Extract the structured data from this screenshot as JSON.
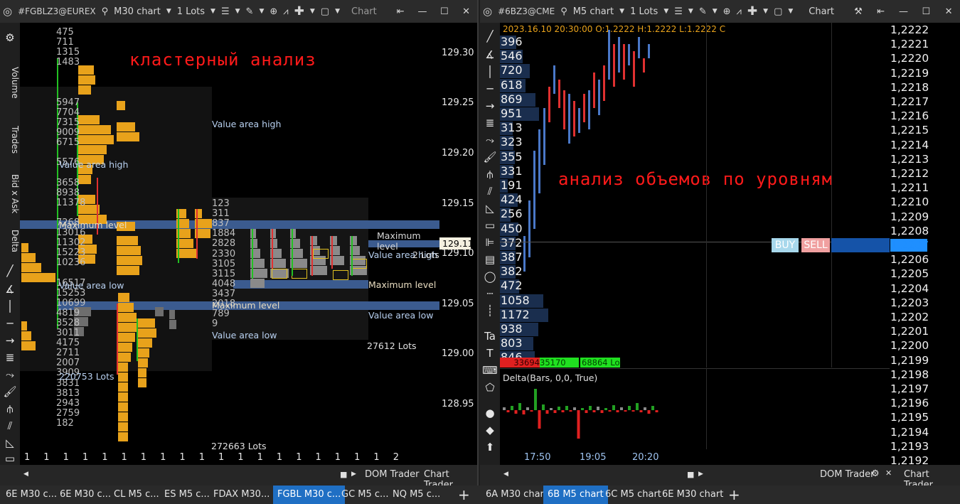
{
  "left": {
    "symbol": "#FGBLZ3@EUREX",
    "chart_type": "M30 chart",
    "lots": "1 Lots",
    "chart_label": "Chart",
    "annotation": "кластерный анализ",
    "side_tabs": [
      "Volume",
      "Trades",
      "Bid x Ask",
      "Delta"
    ],
    "prices": [
      "129.30",
      "129.25",
      "129.20",
      "129.15",
      "129.10",
      "129.05",
      "129.00",
      "128.95"
    ],
    "current_price": "129.11",
    "col1_values": [
      "475",
      "711",
      "1315",
      "1483",
      "",
      "",
      "",
      "5947",
      "7704",
      "7315",
      "9009",
      "6715",
      "",
      "5576",
      "",
      "3658",
      "8938",
      "11378",
      "",
      "7268",
      "13016",
      "11302",
      "15223",
      "10236",
      "",
      "16517",
      "15253",
      "10699",
      "4819",
      "3528",
      "3011",
      "4175",
      "2711",
      "2007",
      "3909",
      "3831",
      "3813",
      "2943",
      "2759",
      "182"
    ],
    "col2_values": [
      "123",
      "311",
      "837",
      "1884",
      "2828",
      "2330",
      "3105",
      "3115",
      "4048",
      "3437",
      "2018",
      "789",
      "9"
    ],
    "labels": {
      "vah1": "Value area high",
      "vah2": "Value area high",
      "vah3": "Value area high",
      "max1": "Maximum level",
      "max2": "Maximum level",
      "max3": "Maximum level",
      "val1": "Value area low",
      "val2": "Value area low",
      "val3": "Value area low",
      "lots1": "220753 Lots",
      "lots2": "27612 Lots",
      "lots3": "272663 Lots",
      "lots_badge": "2 Lots",
      "overlap": "Maximum level"
    },
    "x_ticks": [
      "1",
      "1",
      "1",
      "1",
      "1",
      "1",
      "1",
      "1",
      "1",
      "1",
      "1",
      "1",
      "1",
      "1",
      "1",
      "1",
      "1",
      "1",
      "1",
      "2"
    ],
    "bottom": {
      "dom": "DOM Trader",
      "chart": "Chart Trader"
    }
  },
  "right": {
    "symbol": "#6BZ3@CME",
    "chart_type": "M5 chart",
    "lots": "1 Lots",
    "chart_label": "Chart",
    "ohlc": "2023.16.10 20:30:00 O:1.2222 H:1.2222 L:1.2222 C",
    "annotation": "анализ объемов по уровням",
    "volumes": [
      "396",
      "546",
      "720",
      "618",
      "869",
      "951",
      "313",
      "323",
      "355",
      "331",
      "191",
      "424",
      "256",
      "450",
      "372",
      "387",
      "382",
      "472",
      "1058",
      "1172",
      "938",
      "803",
      "846"
    ],
    "prices": [
      "1,2222",
      "1,2221",
      "1,2220",
      "1,2219",
      "1,2218",
      "1,2217",
      "1,2216",
      "1,2215",
      "1,2214",
      "1,2213",
      "1,2212",
      "1,2211",
      "1,2210",
      "1,2209",
      "1,2208",
      "1,2207",
      "1,2206",
      "1,2205",
      "1,2204",
      "1,2203",
      "1,2202",
      "1,2201",
      "1,2200",
      "1,2199",
      "1,2198",
      "1,2197",
      "1,2196",
      "1,2195",
      "1,2194",
      "1,2193",
      "1,2192"
    ],
    "buy": "BUY",
    "sell": "SELL",
    "bidask": [
      "33694",
      "35170",
      "68864 Lo"
    ],
    "delta_label": "Delta(Bars, 0,0, True)",
    "x_ticks": [
      "17:50",
      "19:05",
      "20:20"
    ],
    "bottom": {
      "dom": "DOM Trader",
      "chart": "Chart Trader"
    }
  },
  "tabs_left": [
    "6E M30 c...",
    "6E M30 c...",
    "CL M5 c...",
    "ES M5 c...",
    "FDAX M30...",
    "FGBL M30 c...",
    "GC M5 c...",
    "NQ M5 c..."
  ],
  "tabs_right": [
    "6A M30 chart",
    "6B M5 chart",
    "6C M5 chart",
    "6E M30 chart"
  ],
  "colors": {
    "accent": "#1f6fc4",
    "annotation": "#ff1a1a",
    "cluster": "#e8a21b",
    "bar_blue": "#4a70b0",
    "candle_red": "#e03030",
    "candle_blue": "#4a78c8"
  }
}
